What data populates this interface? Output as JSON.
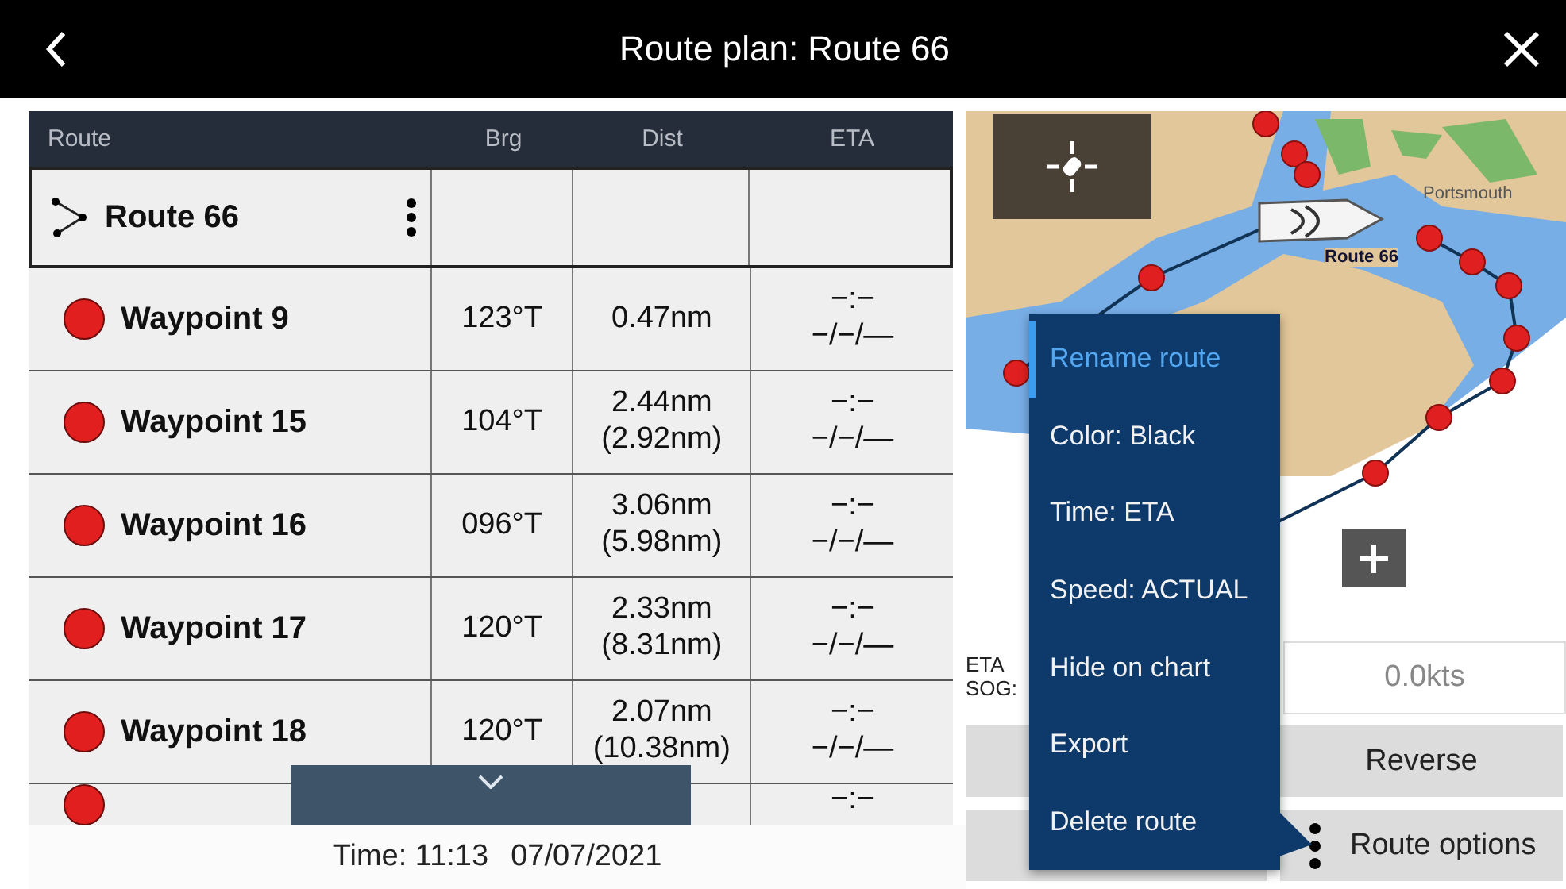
{
  "window": {
    "title": "Route plan: Route 66"
  },
  "table": {
    "columns": [
      "Route",
      "Brg",
      "Dist",
      "ETA"
    ],
    "route": {
      "name": "Route 66",
      "selected": true
    },
    "rows": [
      {
        "name": "Waypoint 9",
        "brg": "123°T",
        "dist": "0.47nm",
        "dist_total": "",
        "eta_time": "−:−",
        "eta_date": "−/−/—"
      },
      {
        "name": "Waypoint 15",
        "brg": "104°T",
        "dist": "2.44nm",
        "dist_total": "(2.92nm)",
        "eta_time": "−:−",
        "eta_date": "−/−/—"
      },
      {
        "name": "Waypoint 16",
        "brg": "096°T",
        "dist": "3.06nm",
        "dist_total": "(5.98nm)",
        "eta_time": "−:−",
        "eta_date": "−/−/—"
      },
      {
        "name": "Waypoint 17",
        "brg": "120°T",
        "dist": "2.33nm",
        "dist_total": "(8.31nm)",
        "eta_time": "−:−",
        "eta_date": "−/−/—"
      },
      {
        "name": "Waypoint 18",
        "brg": "120°T",
        "dist": "2.07nm",
        "dist_total": "(10.38nm)",
        "eta_time": "−:−",
        "eta_date": "−/−/—"
      },
      {
        "name": "",
        "brg": "",
        "dist": "",
        "dist_total": "",
        "eta_time": "−:−",
        "eta_date": ""
      }
    ]
  },
  "status_bar": {
    "time": "Time: 11:13",
    "date": "07/07/2021"
  },
  "map": {
    "place_label": "Portsmouth",
    "route_label": "Route 66"
  },
  "info": {
    "eta_label": "ETA",
    "sog_label": "SOG:",
    "speed_value": "0.0kts"
  },
  "buttons": [
    "Reverse",
    "Route options"
  ],
  "menu": [
    {
      "label": "Rename route",
      "selected": true
    },
    {
      "label": "Color: Black",
      "selected": false
    },
    {
      "label": "Time: ETA",
      "selected": false
    },
    {
      "label": "Speed: ACTUAL",
      "selected": false
    },
    {
      "label": "Hide on chart",
      "selected": false
    },
    {
      "label": "Export",
      "selected": false
    },
    {
      "label": "Delete route",
      "selected": false
    }
  ]
}
